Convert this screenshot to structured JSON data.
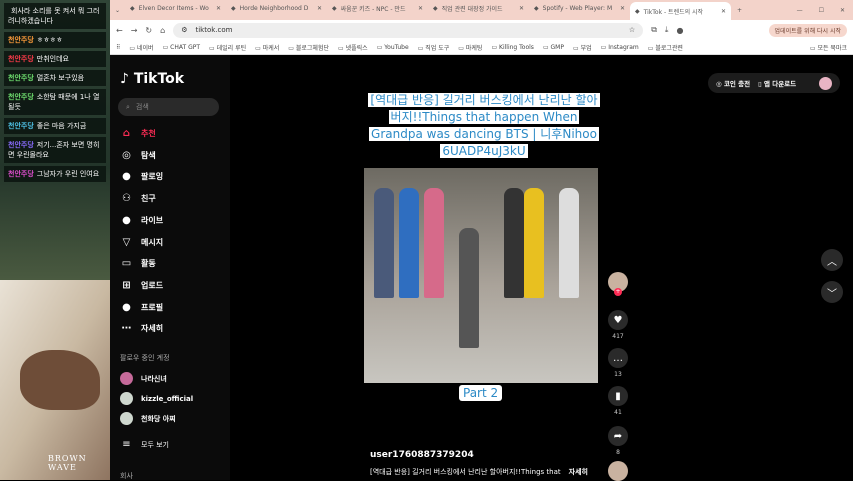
{
  "game_chat": {
    "messages": [
      {
        "name": "",
        "text": "회사라 소리를 못 켜서 뭐 그러려니하겠습니다",
        "color": "#8fd0ff"
      },
      {
        "name": "천안주당",
        "text": "ㅎㅎㅎㅎ",
        "color": "#ff9c3a"
      },
      {
        "name": "천안주당",
        "text": "만취인데요",
        "color": "#ff3b4a"
      },
      {
        "name": "천안주당",
        "text": "멀혼차 보구있음",
        "color": "#6fe06f"
      },
      {
        "name": "천안주당",
        "text": "소한탐 때문에 1나 열될듯",
        "color": "#6fe06f"
      },
      {
        "name": "천안주당",
        "text": "좋은 마음 가지금",
        "color": "#4fc3e8"
      },
      {
        "name": "천안주당",
        "text": "저기...혼자 보면 명히면 우린몰라요",
        "color": "#8a6cff"
      },
      {
        "name": "천안주당",
        "text": "그남자가 우린 인여요",
        "color": "#e04fd0"
      }
    ]
  },
  "photo": {
    "watermark": "BROWN WAVE"
  },
  "browser": {
    "tabs": [
      {
        "label": "Elven Decor Items - Wo"
      },
      {
        "label": "Horde Neighborhood D"
      },
      {
        "label": "싸움꾼 키즈 - NPC - 만드"
      },
      {
        "label": "직업 관련 대장정 가이드"
      },
      {
        "label": "Spotify - Web Player: M"
      },
      {
        "label": "TikTok - 트렌드의 시작"
      }
    ],
    "url": "tiktok.com",
    "update_button": "업데이트를 위해 다시 시작",
    "bookmarks": [
      "네이버",
      "CHAT GPT",
      "데일리 루틴",
      "마케서",
      "블로그체험단",
      "넷플릭스",
      "YouTube",
      "직업 도구",
      "마케팅",
      "Killing Tools",
      "GMP",
      "부업",
      "Instagram",
      "블로그관련",
      "모든 북마크"
    ]
  },
  "tiktok": {
    "logo": "TikTok",
    "search_placeholder": "검색",
    "nav": [
      "추천",
      "탐색",
      "팔로잉",
      "친구",
      "라이브",
      "메시지",
      "활동",
      "업로드",
      "프로필",
      "자세히"
    ],
    "following_header": "팔로우 중인 계정",
    "following": [
      "나라신녀",
      "kizzle_official",
      "천화당 아찌"
    ],
    "see_all": "모두 보기",
    "company": "회사",
    "coin_label": "코인 충전",
    "app_label": "앱 다운로드",
    "video": {
      "title": "[역대급 반응] 길거리 버스킹에서 난리난 할아버지!!Things that happen When Grandpa was dancing BTS | 니후Nihoo 6UADP4uJ3kU",
      "part": "Part 2",
      "user": "user1760887379204",
      "desc": "[역대급 반응] 길거리 버스킹에서 난리난 할아버지!!Things that",
      "more": "자세히",
      "likes": "417",
      "comments": "13",
      "saves": "41",
      "shares": "8"
    },
    "accent": "#fe2c55"
  }
}
